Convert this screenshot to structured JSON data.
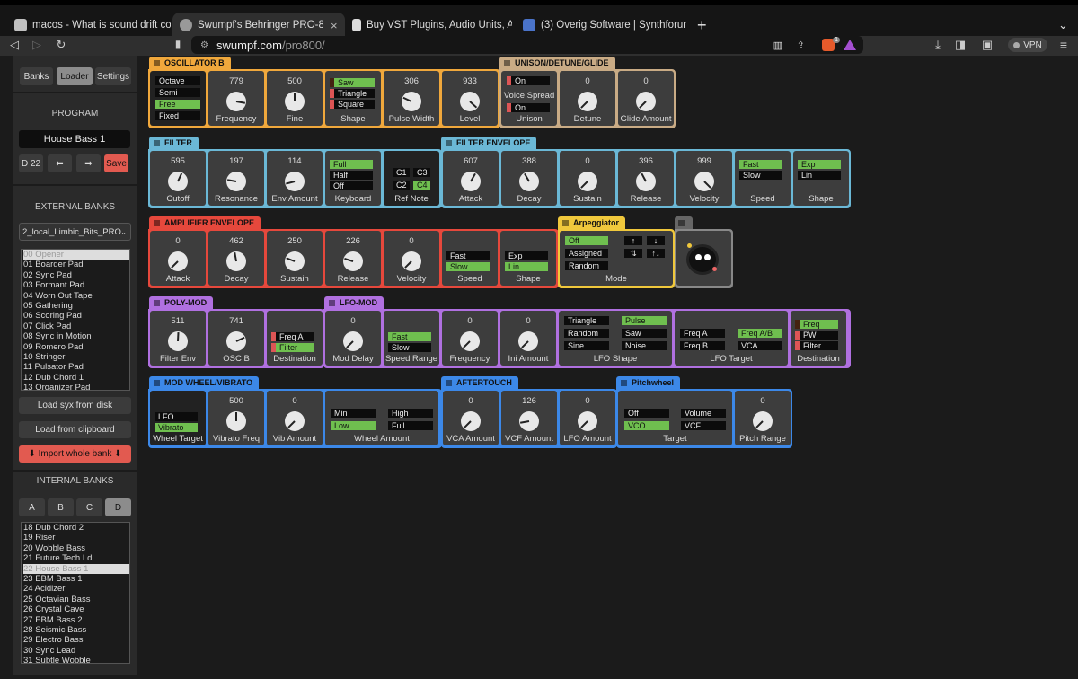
{
  "browser": {
    "tabs": [
      {
        "label": "macos - What is sound drift correct",
        "color": "#c0c0c0"
      },
      {
        "label": "Swumpf's Behringer PRO-800",
        "color": "#999"
      },
      {
        "label": "Buy VST Plugins, Audio Units, AAX,",
        "color": "#ddd"
      },
      {
        "label": "(3) Overig Software | Synthforum",
        "color": "#4a73c9"
      }
    ],
    "close_tab": "×",
    "new_tab": "+",
    "tab_menu": "⌄",
    "url_host": "swumpf.com",
    "url_path": "/pro800/",
    "shield_badge": "1",
    "vpn": "VPN"
  },
  "sidebar": {
    "tabs": [
      "Banks",
      "Loader",
      "Settings"
    ],
    "program_heading": "PROGRAM",
    "program_name": "House Bass 1",
    "patch_id": "D 22",
    "prev": "⬅",
    "next": "➡",
    "save": "Save",
    "external_heading": "EXTERNAL BANKS",
    "bank_select": "2_local_Limbic_Bits_PRO",
    "external_list": [
      "00 Opener",
      "01 Boarder Pad",
      "02 Sync Pad",
      "03 Formant Pad",
      "04 Worn Out Tape",
      "05 Gathering",
      "06 Scoring Pad",
      "07 Click Pad",
      "08 Sync in Motion",
      "09 Romero Pad",
      "10 Stringer",
      "11 Pulsator Pad",
      "12 Dub Chord 1",
      "13 Organizer Pad"
    ],
    "load_syx": "Load syx from disk",
    "load_clip": "Load from clipboard",
    "import_bank": "⬇ Import whole bank ⬇",
    "internal_heading": "INTERNAL BANKS",
    "banks": [
      "A",
      "B",
      "C",
      "D"
    ],
    "internal_list": [
      "18 Dub Chord 2",
      "19 Riser",
      "20 Wobble Bass",
      "21 Future Tech Ld",
      "22 House Bass 1",
      "23 EBM Bass 1",
      "24 Acidizer",
      "25 Octavian Bass",
      "26 Crystal Cave",
      "27 EBM Bass 2",
      "28 Seismic Bass",
      "29 Electro Bass",
      "30 Sync Lead",
      "31 Subtle Wobble"
    ]
  },
  "colors": {
    "osc": "#f0a83c",
    "unison": "#c9ab85",
    "filter": "#6bb8d6",
    "amp": "#e6483c",
    "arp": "#f0c83c",
    "poly": "#b070e0",
    "mod": "#3c88e8",
    "green": "#6fbf4f"
  },
  "osc": {
    "title": "OSCILLATOR B",
    "range_opts": [
      "Octave",
      "Semi",
      "Free",
      "Fixed"
    ],
    "frequency": {
      "value": "779",
      "label": "Frequency"
    },
    "fine": {
      "value": "500",
      "label": "Fine"
    },
    "shape_opts": [
      "Saw",
      "Triangle",
      "Square"
    ],
    "shape_label": "Shape",
    "pw": {
      "value": "306",
      "label": "Pulse Width"
    },
    "level": {
      "value": "933",
      "label": "Level"
    }
  },
  "unison": {
    "title": "UNISON/DETUNE/GLIDE",
    "on1": "On",
    "voice_spread": "Voice Spread",
    "on2": "On",
    "label": "Unison",
    "detune": {
      "value": "0",
      "label": "Detune"
    },
    "glide": {
      "value": "0",
      "label": "Glide Amount"
    }
  },
  "filter": {
    "title": "FILTER",
    "cutoff": {
      "value": "595",
      "label": "Cutoff"
    },
    "res": {
      "value": "197",
      "label": "Resonance"
    },
    "env": {
      "value": "114",
      "label": "Env Amount"
    },
    "kb_opts": [
      "Full",
      "Half",
      "Off"
    ],
    "kb_label": "Keyboard",
    "notes": [
      "C1",
      "C3",
      "C2",
      "C4"
    ],
    "note_label": "Ref Note"
  },
  "fenv": {
    "title": "FILTER ENVELOPE",
    "attack": {
      "value": "607",
      "label": "Attack"
    },
    "decay": {
      "value": "388",
      "label": "Decay"
    },
    "sustain": {
      "value": "0",
      "label": "Sustain"
    },
    "release": {
      "value": "396",
      "label": "Release"
    },
    "velocity": {
      "value": "999",
      "label": "Velocity"
    },
    "speed_opts": [
      "Fast",
      "Slow"
    ],
    "speed_label": "Speed",
    "shape_opts": [
      "Exp",
      "Lin"
    ],
    "shape_label": "Shape"
  },
  "aenv": {
    "title": "AMPLIFIER ENVELOPE",
    "attack": {
      "value": "0",
      "label": "Attack"
    },
    "decay": {
      "value": "462",
      "label": "Decay"
    },
    "sustain": {
      "value": "250",
      "label": "Sustain"
    },
    "release": {
      "value": "226",
      "label": "Release"
    },
    "velocity": {
      "value": "0",
      "label": "Velocity"
    },
    "speed_opts": [
      "Fast",
      "Slow"
    ],
    "speed_label": "Speed",
    "shape_opts": [
      "Exp",
      "Lin"
    ],
    "shape_label": "Shape"
  },
  "arp": {
    "title": "Arpeggiator",
    "opts": [
      "Off",
      "Assigned",
      "Random"
    ],
    "arrows": [
      "↑",
      "↓",
      "⇅",
      "↑↓"
    ],
    "label": "Mode"
  },
  "poly": {
    "title": "POLY-MOD",
    "fenv": {
      "value": "511",
      "label": "Filter Env"
    },
    "oscb": {
      "value": "741",
      "label": "OSC B"
    },
    "dest_opts": [
      "Freq A",
      "Filter"
    ],
    "dest_label": "Destination"
  },
  "lfo": {
    "title": "LFO-MOD",
    "delay": {
      "value": "0",
      "label": "Mod Delay"
    },
    "range_opts": [
      "Fast",
      "Slow"
    ],
    "range_label": "Speed Range",
    "freq": {
      "value": "0",
      "label": "Frequency"
    },
    "ini": {
      "value": "0",
      "label": "Ini Amount"
    },
    "shape_opts": [
      "Triangle",
      "Pulse",
      "Random",
      "Saw",
      "Sine",
      "Noise"
    ],
    "shape_label": "LFO Shape",
    "target_opts": [
      "Freq A",
      "Freq A/B",
      "Freq B",
      "VCA"
    ],
    "target_label": "LFO Target",
    "dest_opts": [
      "Freq",
      "PW",
      "Filter"
    ],
    "dest_label": "Destination"
  },
  "wheel": {
    "title": "MOD WHEEL/VIBRATO",
    "target_opts": [
      "LFO",
      "Vibrato"
    ],
    "target_label": "Wheel Target",
    "vfreq": {
      "value": "500",
      "label": "Vibrato Freq"
    },
    "vamt": {
      "value": "0",
      "label": "Vib Amount"
    },
    "amt_opts": [
      "Min",
      "High",
      "Low",
      "Full"
    ],
    "amt_label": "Wheel Amount"
  },
  "after": {
    "title": "AFTERTOUCH",
    "vca": {
      "value": "0",
      "label": "VCA Amount"
    },
    "vcf": {
      "value": "126",
      "label": "VCF Amount"
    },
    "lfo": {
      "value": "0",
      "label": "LFO Amount"
    }
  },
  "pitch": {
    "title": "Pitchwheel",
    "opts": [
      "Off",
      "Volume",
      "VCO",
      "VCF"
    ],
    "label": "Target",
    "range": {
      "value": "0",
      "label": "Pitch Range"
    }
  }
}
